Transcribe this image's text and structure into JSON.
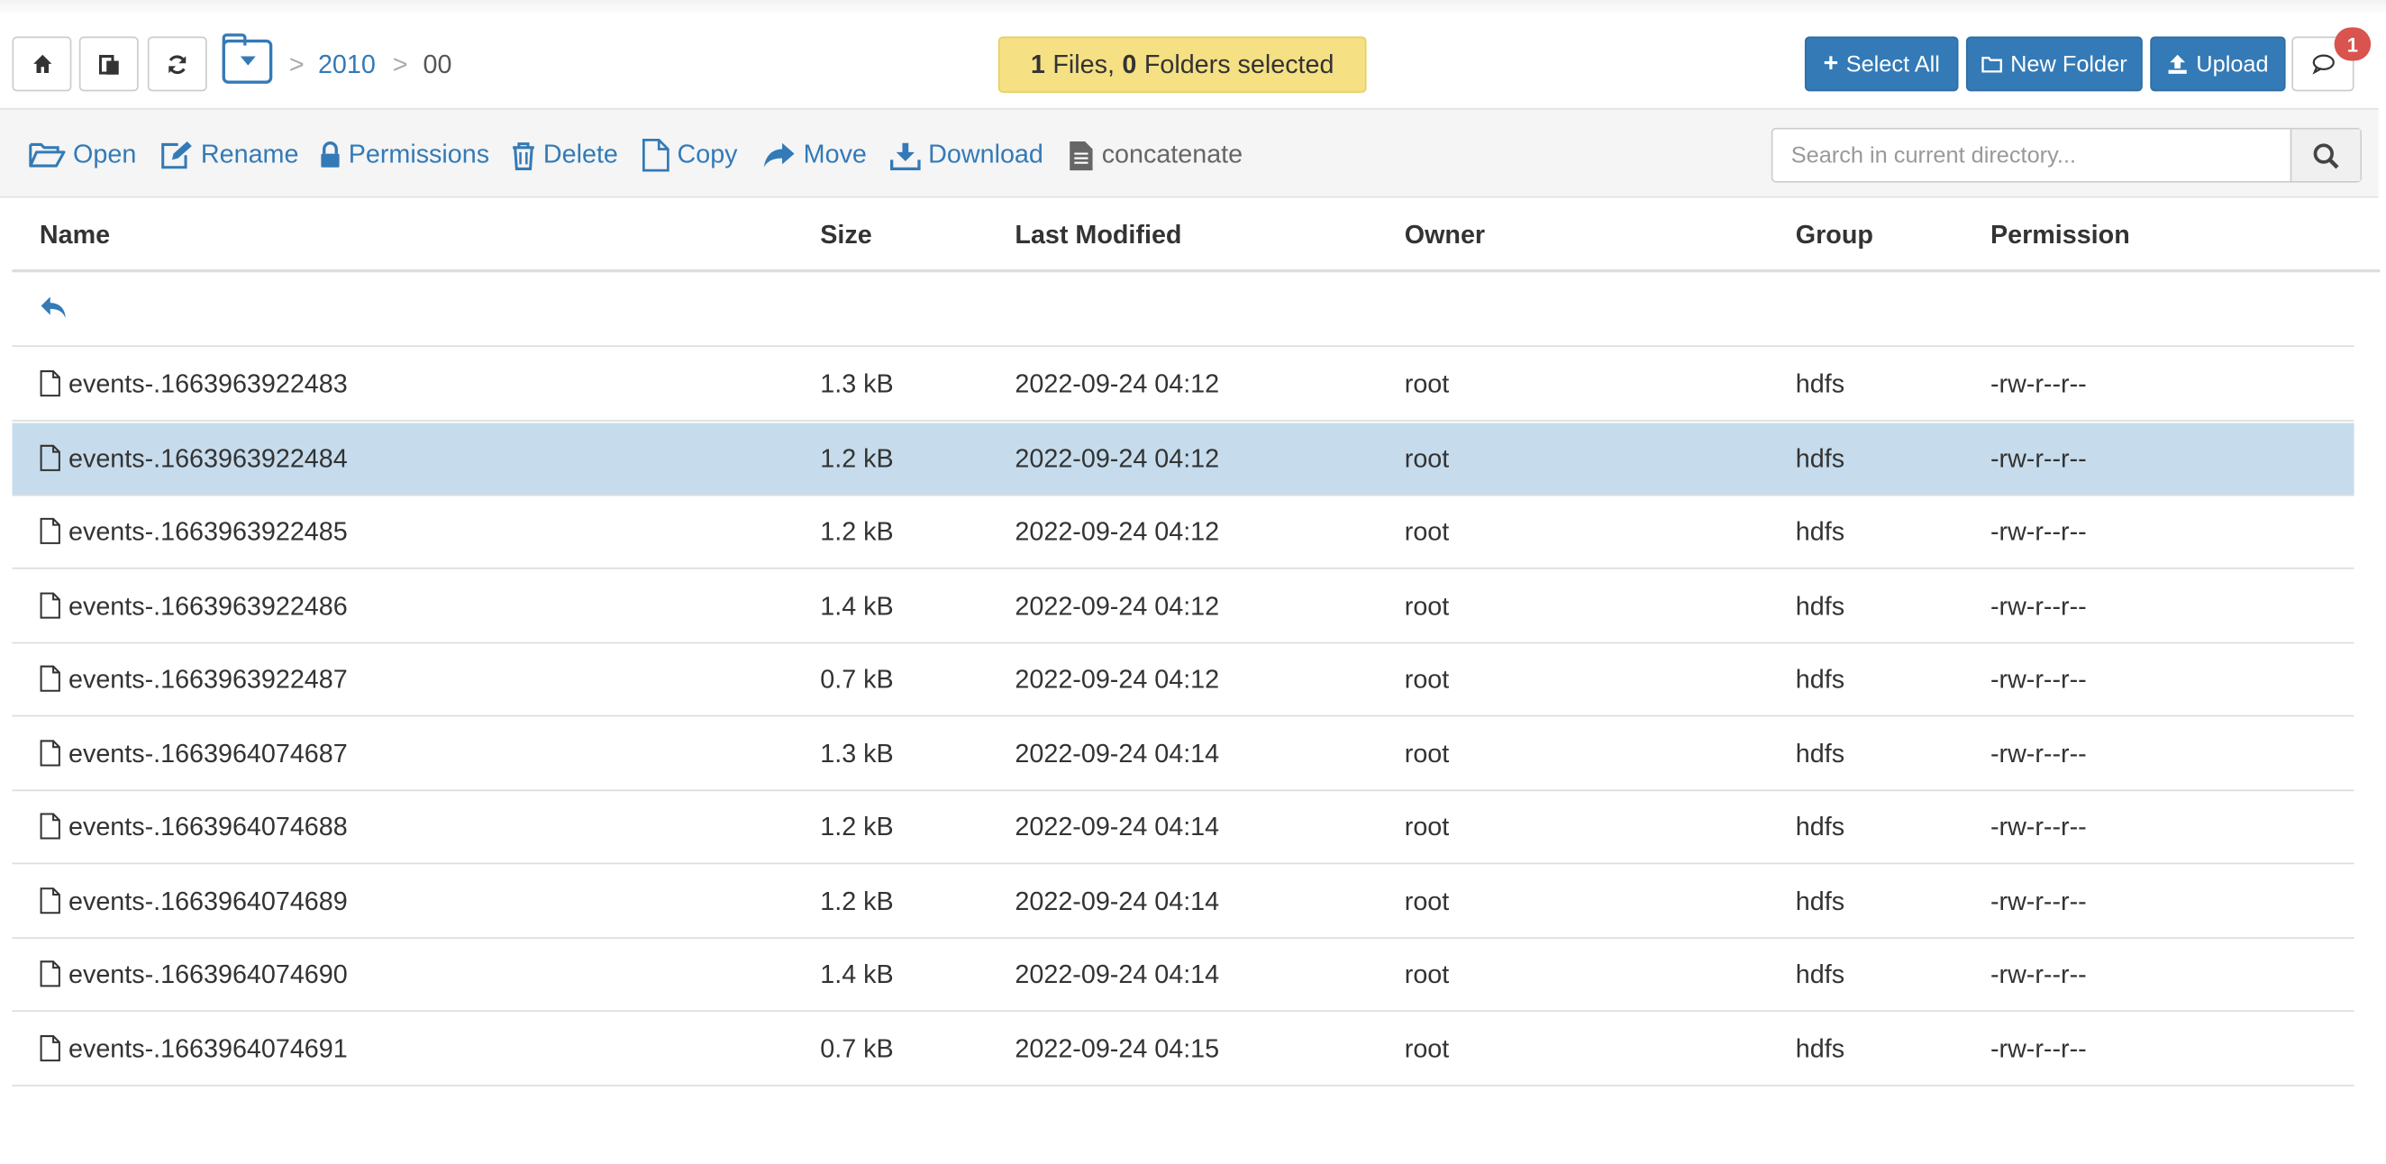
{
  "toolbar": {
    "breadcrumb": [
      "2010",
      "00"
    ],
    "breadcrumb_sep": ">",
    "selection": {
      "files_count": "1",
      "files_label": "Files,",
      "folders_count": "0",
      "folders_label": "Folders selected"
    },
    "select_all_label": "Select All",
    "new_folder_label": "New Folder",
    "upload_label": "Upload",
    "notification_count": "1"
  },
  "actions": {
    "open": "Open",
    "rename": "Rename",
    "permissions": "Permissions",
    "delete": "Delete",
    "copy": "Copy",
    "move": "Move",
    "download": "Download",
    "concatenate": "concatenate"
  },
  "search": {
    "placeholder": "Search in current directory..."
  },
  "table": {
    "headers": {
      "name": "Name",
      "size": "Size",
      "modified": "Last Modified",
      "owner": "Owner",
      "group": "Group",
      "permission": "Permission"
    },
    "rows": [
      {
        "name": "events-.1663963922483",
        "size": "1.3 kB",
        "modified": "2022-09-24 04:12",
        "owner": "root",
        "group": "hdfs",
        "permission": "-rw-r--r--",
        "selected": false
      },
      {
        "name": "events-.1663963922484",
        "size": "1.2 kB",
        "modified": "2022-09-24 04:12",
        "owner": "root",
        "group": "hdfs",
        "permission": "-rw-r--r--",
        "selected": true
      },
      {
        "name": "events-.1663963922485",
        "size": "1.2 kB",
        "modified": "2022-09-24 04:12",
        "owner": "root",
        "group": "hdfs",
        "permission": "-rw-r--r--",
        "selected": false
      },
      {
        "name": "events-.1663963922486",
        "size": "1.4 kB",
        "modified": "2022-09-24 04:12",
        "owner": "root",
        "group": "hdfs",
        "permission": "-rw-r--r--",
        "selected": false
      },
      {
        "name": "events-.1663963922487",
        "size": "0.7 kB",
        "modified": "2022-09-24 04:12",
        "owner": "root",
        "group": "hdfs",
        "permission": "-rw-r--r--",
        "selected": false
      },
      {
        "name": "events-.1663964074687",
        "size": "1.3 kB",
        "modified": "2022-09-24 04:14",
        "owner": "root",
        "group": "hdfs",
        "permission": "-rw-r--r--",
        "selected": false
      },
      {
        "name": "events-.1663964074688",
        "size": "1.2 kB",
        "modified": "2022-09-24 04:14",
        "owner": "root",
        "group": "hdfs",
        "permission": "-rw-r--r--",
        "selected": false
      },
      {
        "name": "events-.1663964074689",
        "size": "1.2 kB",
        "modified": "2022-09-24 04:14",
        "owner": "root",
        "group": "hdfs",
        "permission": "-rw-r--r--",
        "selected": false
      },
      {
        "name": "events-.1663964074690",
        "size": "1.4 kB",
        "modified": "2022-09-24 04:14",
        "owner": "root",
        "group": "hdfs",
        "permission": "-rw-r--r--",
        "selected": false
      },
      {
        "name": "events-.1663964074691",
        "size": "0.7 kB",
        "modified": "2022-09-24 04:15",
        "owner": "root",
        "group": "hdfs",
        "permission": "-rw-r--r--",
        "selected": false
      }
    ]
  },
  "colors": {
    "accent": "#337ab7",
    "selection_row": "#c6dcec",
    "selection_box": "#f5e083",
    "badge": "#d9534f"
  }
}
